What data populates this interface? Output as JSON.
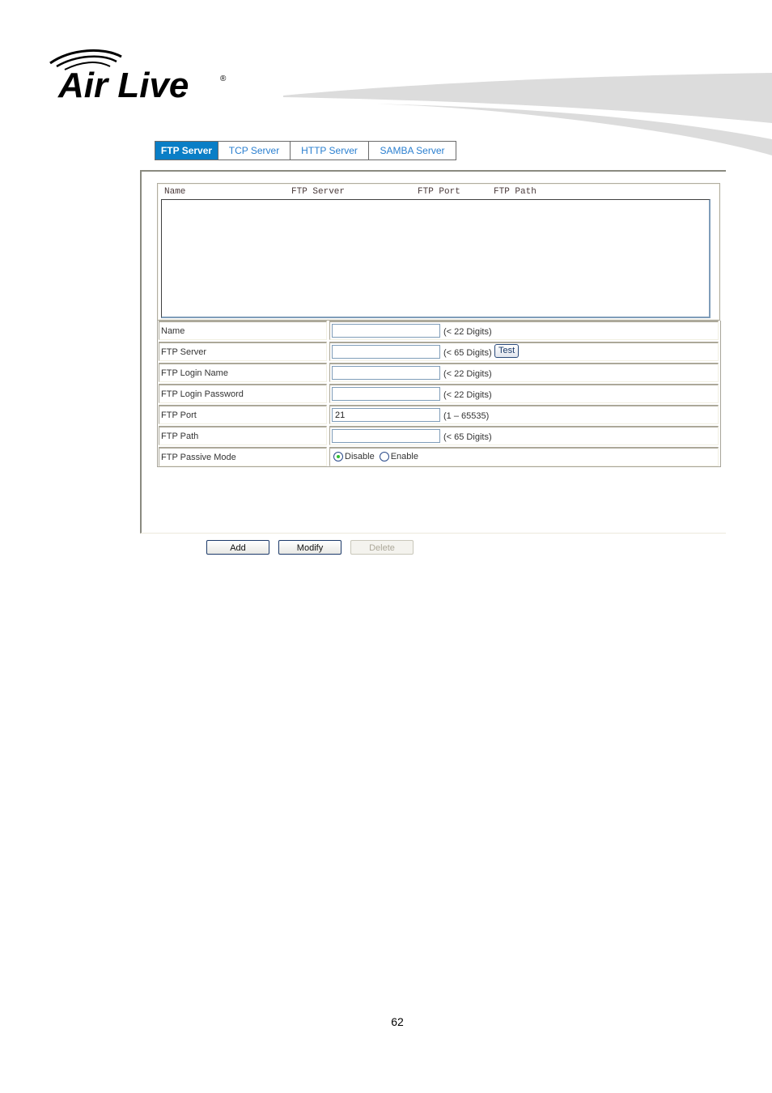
{
  "brand": {
    "logo_text": "Air Live",
    "registered_mark": "®",
    "logo_icon": "wifi-arcs-logo"
  },
  "tabs": [
    {
      "label": "FTP Server",
      "active": true
    },
    {
      "label": "TCP Server",
      "active": false
    },
    {
      "label": "HTTP Server",
      "active": false
    },
    {
      "label": "SAMBA Server",
      "active": false
    }
  ],
  "list": {
    "columns": [
      "Name",
      "FTP Server",
      "FTP Port",
      "FTP Path"
    ],
    "rows": []
  },
  "form": {
    "fields": [
      {
        "label": "Name",
        "value": "",
        "hint": "(< 22 Digits)"
      },
      {
        "label": "FTP Server",
        "value": "",
        "hint": "(< 65 Digits)",
        "button": "Test"
      },
      {
        "label": "FTP Login Name",
        "value": "",
        "hint": "(< 22 Digits)"
      },
      {
        "label": "FTP Login Password",
        "value": "",
        "hint": "(< 22 Digits)"
      },
      {
        "label": "FTP Port",
        "value": "21",
        "hint": "(1 – 65535)"
      },
      {
        "label": "FTP Path",
        "value": "",
        "hint": "(< 65 Digits)"
      }
    ],
    "passive_mode": {
      "label": "FTP Passive Mode",
      "options": [
        {
          "label": "Disable",
          "checked": true
        },
        {
          "label": "Enable",
          "checked": false
        }
      ]
    }
  },
  "buttons": {
    "add": "Add",
    "modify": "Modify",
    "delete": "Delete",
    "delete_disabled": true
  },
  "colors": {
    "active_tab_bg": "#0a7ec6",
    "tab_text": "#2a7fd0"
  },
  "page_number": "62"
}
